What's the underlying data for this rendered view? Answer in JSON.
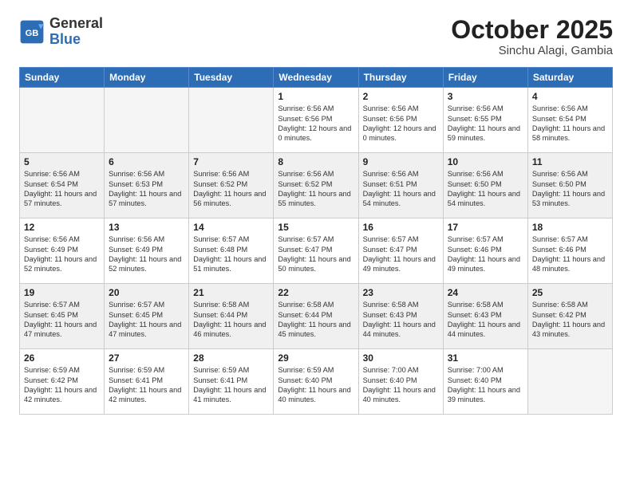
{
  "logo": {
    "text_general": "General",
    "text_blue": "Blue"
  },
  "header": {
    "month": "October 2025",
    "location": "Sinchu Alagi, Gambia"
  },
  "weekdays": [
    "Sunday",
    "Monday",
    "Tuesday",
    "Wednesday",
    "Thursday",
    "Friday",
    "Saturday"
  ],
  "weeks": [
    [
      {
        "day": "",
        "info": ""
      },
      {
        "day": "",
        "info": ""
      },
      {
        "day": "",
        "info": ""
      },
      {
        "day": "1",
        "info": "Sunrise: 6:56 AM\nSunset: 6:56 PM\nDaylight: 12 hours\nand 0 minutes."
      },
      {
        "day": "2",
        "info": "Sunrise: 6:56 AM\nSunset: 6:56 PM\nDaylight: 12 hours\nand 0 minutes."
      },
      {
        "day": "3",
        "info": "Sunrise: 6:56 AM\nSunset: 6:55 PM\nDaylight: 11 hours\nand 59 minutes."
      },
      {
        "day": "4",
        "info": "Sunrise: 6:56 AM\nSunset: 6:54 PM\nDaylight: 11 hours\nand 58 minutes."
      }
    ],
    [
      {
        "day": "5",
        "info": "Sunrise: 6:56 AM\nSunset: 6:54 PM\nDaylight: 11 hours\nand 57 minutes."
      },
      {
        "day": "6",
        "info": "Sunrise: 6:56 AM\nSunset: 6:53 PM\nDaylight: 11 hours\nand 57 minutes."
      },
      {
        "day": "7",
        "info": "Sunrise: 6:56 AM\nSunset: 6:52 PM\nDaylight: 11 hours\nand 56 minutes."
      },
      {
        "day": "8",
        "info": "Sunrise: 6:56 AM\nSunset: 6:52 PM\nDaylight: 11 hours\nand 55 minutes."
      },
      {
        "day": "9",
        "info": "Sunrise: 6:56 AM\nSunset: 6:51 PM\nDaylight: 11 hours\nand 54 minutes."
      },
      {
        "day": "10",
        "info": "Sunrise: 6:56 AM\nSunset: 6:50 PM\nDaylight: 11 hours\nand 54 minutes."
      },
      {
        "day": "11",
        "info": "Sunrise: 6:56 AM\nSunset: 6:50 PM\nDaylight: 11 hours\nand 53 minutes."
      }
    ],
    [
      {
        "day": "12",
        "info": "Sunrise: 6:56 AM\nSunset: 6:49 PM\nDaylight: 11 hours\nand 52 minutes."
      },
      {
        "day": "13",
        "info": "Sunrise: 6:56 AM\nSunset: 6:49 PM\nDaylight: 11 hours\nand 52 minutes."
      },
      {
        "day": "14",
        "info": "Sunrise: 6:57 AM\nSunset: 6:48 PM\nDaylight: 11 hours\nand 51 minutes."
      },
      {
        "day": "15",
        "info": "Sunrise: 6:57 AM\nSunset: 6:47 PM\nDaylight: 11 hours\nand 50 minutes."
      },
      {
        "day": "16",
        "info": "Sunrise: 6:57 AM\nSunset: 6:47 PM\nDaylight: 11 hours\nand 49 minutes."
      },
      {
        "day": "17",
        "info": "Sunrise: 6:57 AM\nSunset: 6:46 PM\nDaylight: 11 hours\nand 49 minutes."
      },
      {
        "day": "18",
        "info": "Sunrise: 6:57 AM\nSunset: 6:46 PM\nDaylight: 11 hours\nand 48 minutes."
      }
    ],
    [
      {
        "day": "19",
        "info": "Sunrise: 6:57 AM\nSunset: 6:45 PM\nDaylight: 11 hours\nand 47 minutes."
      },
      {
        "day": "20",
        "info": "Sunrise: 6:57 AM\nSunset: 6:45 PM\nDaylight: 11 hours\nand 47 minutes."
      },
      {
        "day": "21",
        "info": "Sunrise: 6:58 AM\nSunset: 6:44 PM\nDaylight: 11 hours\nand 46 minutes."
      },
      {
        "day": "22",
        "info": "Sunrise: 6:58 AM\nSunset: 6:44 PM\nDaylight: 11 hours\nand 45 minutes."
      },
      {
        "day": "23",
        "info": "Sunrise: 6:58 AM\nSunset: 6:43 PM\nDaylight: 11 hours\nand 44 minutes."
      },
      {
        "day": "24",
        "info": "Sunrise: 6:58 AM\nSunset: 6:43 PM\nDaylight: 11 hours\nand 44 minutes."
      },
      {
        "day": "25",
        "info": "Sunrise: 6:58 AM\nSunset: 6:42 PM\nDaylight: 11 hours\nand 43 minutes."
      }
    ],
    [
      {
        "day": "26",
        "info": "Sunrise: 6:59 AM\nSunset: 6:42 PM\nDaylight: 11 hours\nand 42 minutes."
      },
      {
        "day": "27",
        "info": "Sunrise: 6:59 AM\nSunset: 6:41 PM\nDaylight: 11 hours\nand 42 minutes."
      },
      {
        "day": "28",
        "info": "Sunrise: 6:59 AM\nSunset: 6:41 PM\nDaylight: 11 hours\nand 41 minutes."
      },
      {
        "day": "29",
        "info": "Sunrise: 6:59 AM\nSunset: 6:40 PM\nDaylight: 11 hours\nand 40 minutes."
      },
      {
        "day": "30",
        "info": "Sunrise: 7:00 AM\nSunset: 6:40 PM\nDaylight: 11 hours\nand 40 minutes."
      },
      {
        "day": "31",
        "info": "Sunrise: 7:00 AM\nSunset: 6:40 PM\nDaylight: 11 hours\nand 39 minutes."
      },
      {
        "day": "",
        "info": ""
      }
    ]
  ]
}
